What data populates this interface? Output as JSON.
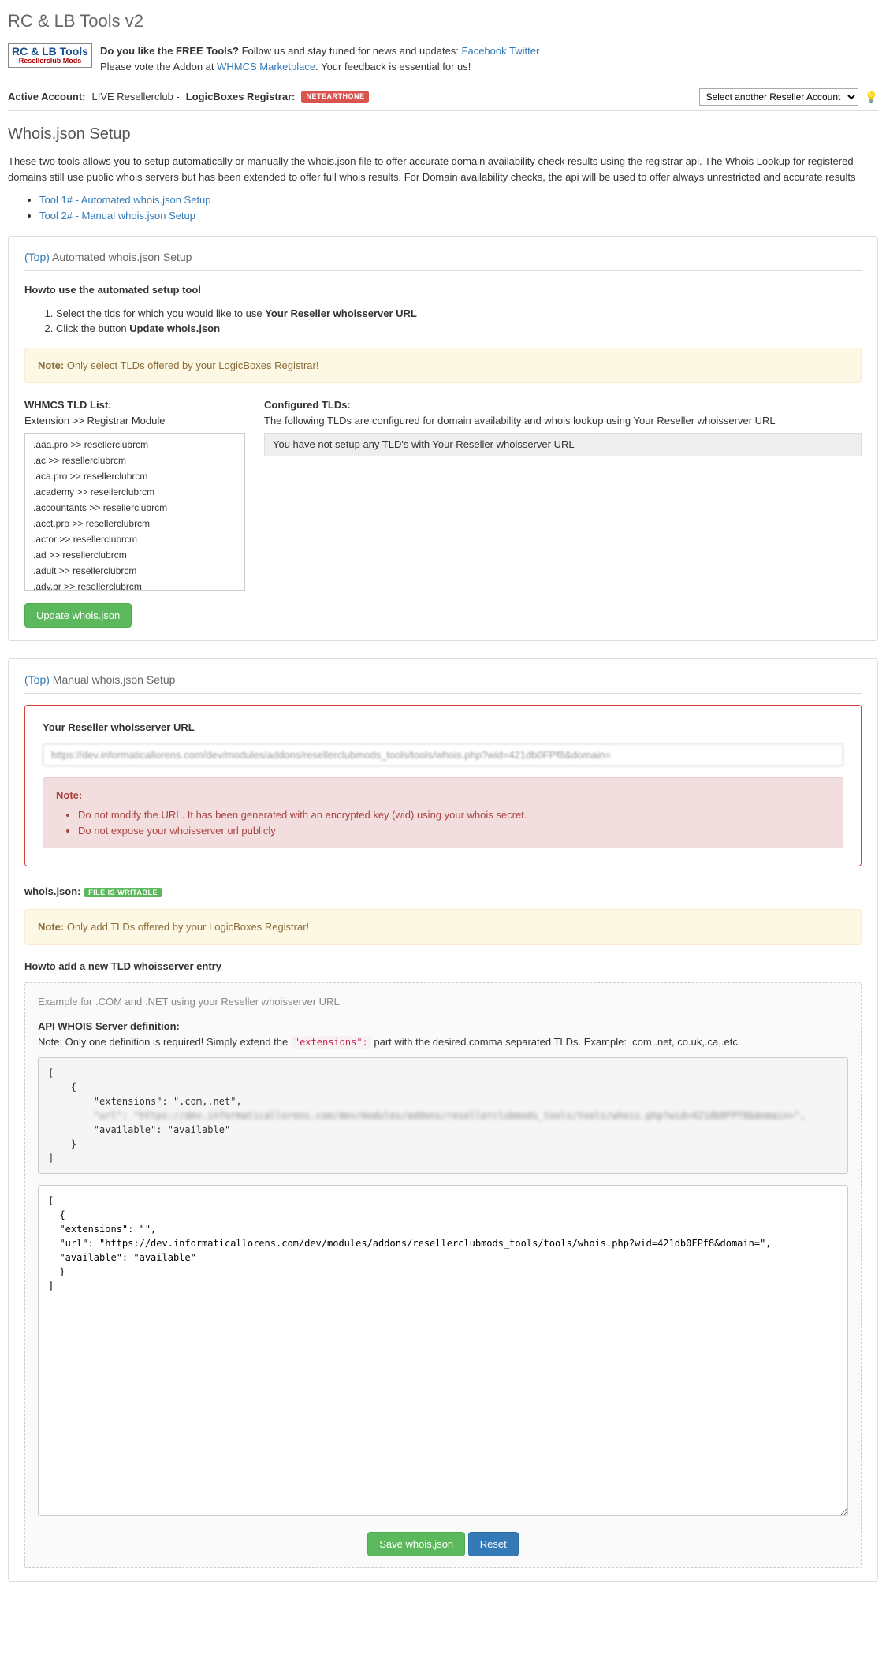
{
  "page_title": "RC & LB Tools v2",
  "header": {
    "like_q": "Do you like the FREE Tools?",
    "follow": " Follow us and stay tuned for news and updates: ",
    "fb": "Facebook",
    "tw": "Twitter",
    "vote_pre": "Please vote the Addon at ",
    "vote_link": "WHMCS Marketplace",
    "vote_post": ". Your feedback is essential for us!"
  },
  "account": {
    "label": "Active Account:",
    "live": "LIVE Resellerclub - ",
    "reg": "LogicBoxes Registrar:",
    "badge": "NETEARTHONE",
    "select": "Select another Reseller Account"
  },
  "section_title": "Whois.json Setup",
  "intro": "These two tools allows you to setup automatically or manually the whois.json file to offer accurate domain availability check results using the registrar api. The Whois Lookup for registered domains still use public whois servers but has been extended to offer full whois results. For Domain availability checks, the api will be used to offer always unrestricted and accurate results",
  "tool1": "Tool 1# - Automated whois.json Setup",
  "tool2": "Tool 2# - Manual whois.json Setup",
  "auto": {
    "top": "(Top)",
    "title": " Automated whois.json Setup",
    "howto": "Howto use the automated setup tool",
    "step1_a": "Select the tlds for which you would like to use ",
    "step1_b": "Your Reseller whoisserver URL",
    "step2_a": "Click the button ",
    "step2_b": "Update whois.json",
    "note_b": "Note:",
    "note_t": " Only select TLDs offered by your LogicBoxes Registrar!",
    "list_h": "WHMCS TLD List:",
    "list_sub": "Extension >> Registrar Module",
    "tlds": [
      ".aaa.pro >> resellerclubrcm",
      ".ac >> resellerclubrcm",
      ".aca.pro >> resellerclubrcm",
      ".academy >> resellerclubrcm",
      ".accountants >> resellerclubrcm",
      ".acct.pro >> resellerclubrcm",
      ".actor >> resellerclubrcm",
      ".ad >> resellerclubrcm",
      ".adult >> resellerclubrcm",
      ".adv.br >> resellerclubrcm"
    ],
    "conf_h": "Configured TLDs:",
    "conf_sub": "The following TLDs are configured for domain availability and whois lookup using Your Reseller whoisserver URL",
    "conf_msg": "You have not setup any TLD's with Your Reseller whoisserver URL",
    "btn": "Update whois.json"
  },
  "manual": {
    "top": "(Top)",
    "title": " Manual whois.json Setup",
    "url_label": "Your Reseller whoisserver URL",
    "url_value": "https://dev.informaticallorens.com/dev/modules/addons/resellerclubmods_tools/tools/whois.php?wid=421db0FPf8&domain=",
    "note_b": "Note:",
    "note1": "Do not modify the URL. It has been generated with an encrypted key (wid) using your whois secret.",
    "note2": "Do not expose your whoisserver url publicly"
  },
  "whois": {
    "label": "whois.json:",
    "badge": "FILE IS WRITABLE",
    "note_b": "Note:",
    "note_t": " Only add TLDs offered by your LogicBoxes Registrar!",
    "howto": "Howto add a new TLD whoisserver entry",
    "example_t": "Example for .COM and .NET using your Reseller whoisserver URL",
    "def_t": "API WHOIS Server definition:",
    "def_note_a": "Note: Only one definition is required! Simply extend the ",
    "def_code": "\"extensions\":",
    "def_note_b": " part with the desired comma separated TLDs. Example: .com,.net,.co.uk,.ca,.etc",
    "code_line1": "[",
    "code_line2": "    {",
    "code_line3": "        \"extensions\": \".com,.net\",",
    "code_line4_blur": "        \"url\": \"https://dev.informaticallorens.com/dev/modules/addons/resellerclubmods_tools/tools/whois.php?wid=421db0FPf8&domain=\",",
    "code_line5": "        \"available\": \"available\"",
    "code_line6": "    }",
    "code_line7": "]",
    "textarea_val": "[\n  {\n  \"extensions\": \"\",\n  \"url\": \"https://dev.informaticallorens.com/dev/modules/addons/resellerclubmods_tools/tools/whois.php?wid=421db0FPf8&domain=\",\n  \"available\": \"available\"\n  }\n]",
    "save_btn": "Save whois.json",
    "reset_btn": "Reset"
  }
}
